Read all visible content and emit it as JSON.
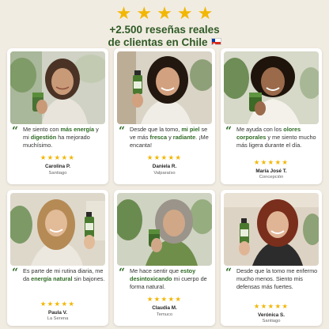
{
  "header": {
    "rating_stars": 5,
    "headline_line1": "+2.500 reseñas reales",
    "headline_line2": "de clientas en Chile"
  },
  "colors": {
    "accent_green": "#2f6b25",
    "star_gold": "#f2b705",
    "background": "#f1ece2"
  },
  "testimonials": [
    {
      "text_parts": [
        {
          "t": "Me siento con ",
          "b": false
        },
        {
          "t": "más energía",
          "b": true
        },
        {
          "t": " y mi ",
          "b": false
        },
        {
          "t": "digestión",
          "b": true
        },
        {
          "t": " ha mejorado muchísimo.",
          "b": false
        }
      ],
      "stars": 5,
      "name": "Carolina P.",
      "city": "Santiago"
    },
    {
      "text_parts": [
        {
          "t": "Desde que la tomo, ",
          "b": false
        },
        {
          "t": "mi piel",
          "b": true
        },
        {
          "t": " se ve más ",
          "b": false
        },
        {
          "t": "fresca",
          "b": true
        },
        {
          "t": " y ",
          "b": false
        },
        {
          "t": "radiante",
          "b": true
        },
        {
          "t": ". ¡Me encanta!",
          "b": false
        }
      ],
      "stars": 5,
      "name": "Daniela R.",
      "city": "Valparaíso"
    },
    {
      "text_parts": [
        {
          "t": "Me ayuda con los ",
          "b": false
        },
        {
          "t": "olores corporales",
          "b": true
        },
        {
          "t": " y me siento mucho más ligera durante el día.",
          "b": false
        }
      ],
      "stars": 5,
      "name": "María José T.",
      "city": "Concepción"
    },
    {
      "text_parts": [
        {
          "t": "Es parte de mi rutina diaria, me da ",
          "b": false
        },
        {
          "t": "energía natural",
          "b": true
        },
        {
          "t": " sin bajones.",
          "b": false
        }
      ],
      "stars": 5,
      "name": "Paula V.",
      "city": "La Serena"
    },
    {
      "text_parts": [
        {
          "t": "Me hace sentir que ",
          "b": false
        },
        {
          "t": "estoy desintoxicando",
          "b": true
        },
        {
          "t": " mi cuerpo de forma natural.",
          "b": false
        }
      ],
      "stars": 5,
      "name": "Claudia M.",
      "city": "Temuco"
    },
    {
      "text_parts": [
        {
          "t": "Desde que la tomo me enfermo mucho menos. Siento mis defensas más fuertes.",
          "b": false
        }
      ],
      "stars": 5,
      "name": "Verónica S.",
      "city": "Santiago"
    }
  ]
}
